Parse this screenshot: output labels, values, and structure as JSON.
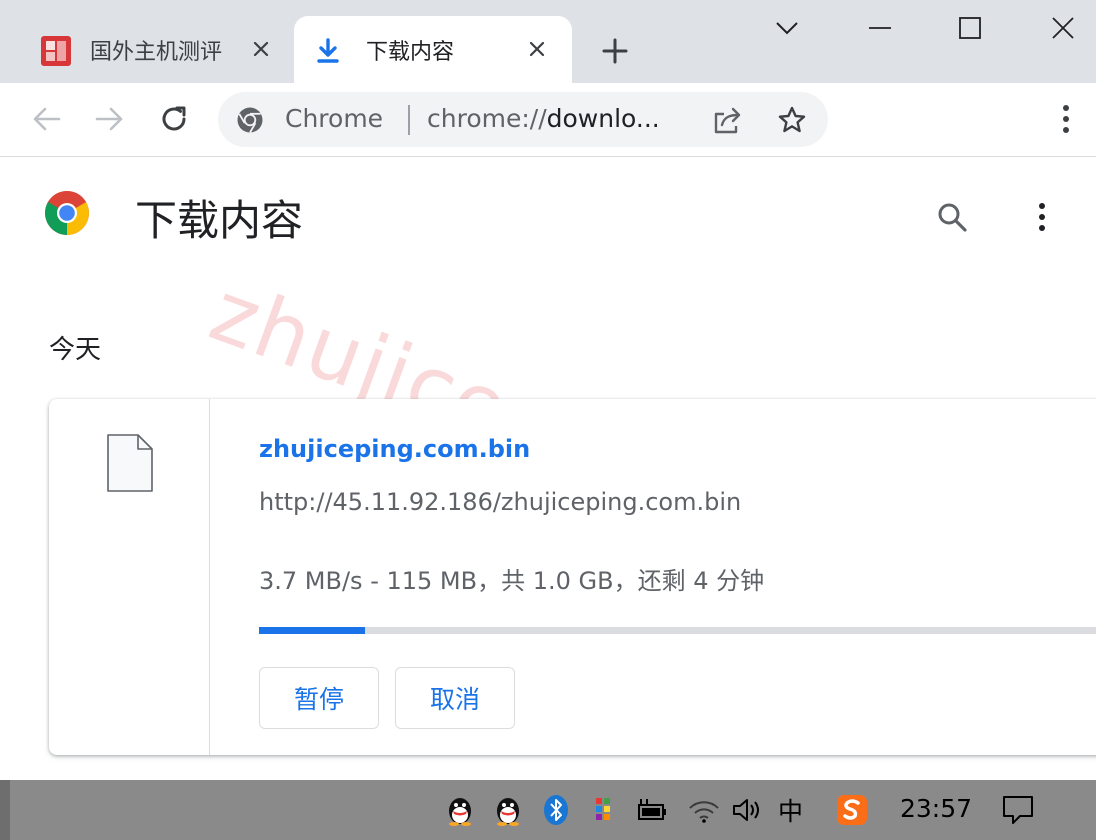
{
  "tabs": [
    {
      "title": "国外主机测评",
      "active": false,
      "icon": "site-favicon"
    },
    {
      "title": "下载内容",
      "active": true,
      "icon": "download-icon"
    }
  ],
  "toolbar": {
    "omnibox": {
      "site_name": "Chrome",
      "url_scheme": "chrome://",
      "url_rest": "downlo..."
    }
  },
  "page": {
    "title": "下载内容",
    "watermark": "zhujiceping.com",
    "date_header": "今天",
    "download": {
      "file_name": "zhujiceping.com.bin",
      "url": "http://45.11.92.186/zhujiceping.com.bin",
      "status": "3.7 MB/s - 115 MB，共 1.0 GB，还剩 4 分钟",
      "progress_fraction": 0.1229,
      "pause_label": "暂停",
      "cancel_label": "取消"
    }
  },
  "taskbar": {
    "ime": "中",
    "clock": "23:57"
  },
  "colors": {
    "accent": "#1a73e8",
    "tabstrip": "#dee1e6",
    "omnibox": "#f1f3f4",
    "taskbar": "#8a8a8a",
    "watermark": "#f5b5b5"
  }
}
